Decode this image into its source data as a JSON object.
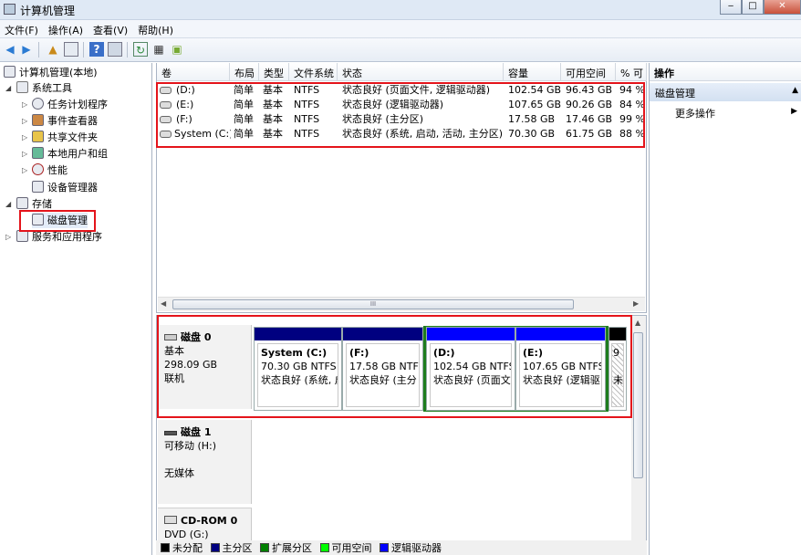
{
  "window": {
    "title": "计算机管理",
    "min": "‒",
    "max": "□",
    "close": "✕"
  },
  "menu": [
    "文件(F)",
    "操作(A)",
    "查看(V)",
    "帮助(H)"
  ],
  "tree": {
    "root": "计算机管理(本地)",
    "system_tools": "系统工具",
    "task_scheduler": "任务计划程序",
    "event_viewer": "事件查看器",
    "shared_folders": "共享文件夹",
    "local_users": "本地用户和组",
    "performance": "性能",
    "device_manager": "设备管理器",
    "storage": "存储",
    "disk_management": "磁盘管理",
    "services_apps": "服务和应用程序"
  },
  "volume_table": {
    "headers": [
      "卷",
      "布局",
      "类型",
      "文件系统",
      "状态",
      "容量",
      "可用空间",
      "% 可"
    ],
    "rows": [
      {
        "vol": "(D:)",
        "layout": "简单",
        "type": "基本",
        "fs": "NTFS",
        "status": "状态良好 (页面文件, 逻辑驱动器)",
        "cap": "102.54 GB",
        "free": "96.43 GB",
        "pct": "94 %"
      },
      {
        "vol": "(E:)",
        "layout": "简单",
        "type": "基本",
        "fs": "NTFS",
        "status": "状态良好 (逻辑驱动器)",
        "cap": "107.65 GB",
        "free": "90.26 GB",
        "pct": "84 %"
      },
      {
        "vol": "(F:)",
        "layout": "简单",
        "type": "基本",
        "fs": "NTFS",
        "status": "状态良好 (主分区)",
        "cap": "17.58 GB",
        "free": "17.46 GB",
        "pct": "99 %"
      },
      {
        "vol": "System (C:)",
        "layout": "简单",
        "type": "基本",
        "fs": "NTFS",
        "status": "状态良好 (系统, 启动, 活动, 主分区)",
        "cap": "70.30 GB",
        "free": "61.75 GB",
        "pct": "88 %"
      }
    ]
  },
  "scroll_grip": "III",
  "disks": [
    {
      "name": "磁盘 0",
      "kind": "基本",
      "size": "298.09 GB",
      "state": "联机"
    },
    {
      "name": "磁盘 1",
      "kind": "可移动 (H:)",
      "size": "",
      "state": "无媒体"
    },
    {
      "name": "CD-ROM 0",
      "kind": "DVD (G:)",
      "size": "",
      "state": ""
    }
  ],
  "partitions": [
    {
      "name": "System  (C:)",
      "size": "70.30 GB NTFS",
      "status": "状态良好 (系统, 启"
    },
    {
      "name": "(F:)",
      "size": "17.58 GB NTF",
      "status": "状态良好 (主分"
    },
    {
      "name": "(D:)",
      "size": "102.54 GB NTFS",
      "status": "状态良好 (页面文"
    },
    {
      "name": "(E:)",
      "size": "107.65 GB NTFS",
      "status": "状态良好 (逻辑驱"
    },
    {
      "name": "9",
      "size": "",
      "status": "未"
    }
  ],
  "actions": {
    "header": "操作",
    "section": "磁盘管理",
    "more": "更多操作"
  },
  "legend": [
    "未分配",
    "主分区",
    "扩展分区",
    "可用空间",
    "逻辑驱动器"
  ],
  "colors": {
    "unallocated": "#000000",
    "primary": "#000080",
    "extended": "#008000",
    "free": "#00ff00",
    "logical": "#0000ff",
    "highlight_red": "#e4141b",
    "selected_green": "#1e7d1e"
  }
}
